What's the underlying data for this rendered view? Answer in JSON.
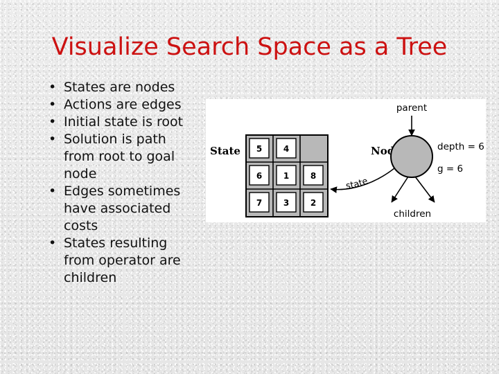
{
  "slide": {
    "title": "Visualize Search Space as a Tree",
    "title_color": "#cc1111",
    "background_color": "#e9e9e9",
    "bullet_marker": "•",
    "bullets": [
      "States are nodes",
      "Actions are edges",
      "Initial state is root",
      "Solution is path from root to goal node",
      "Edges sometimes have associated costs",
      "States resulting from operator are children"
    ]
  },
  "diagram": {
    "panel_background": "#ffffff",
    "state_label": "State",
    "node_label": "Node",
    "parent_label": "parent",
    "children_label": "children",
    "state_arc_label": "state",
    "depth_label": "depth = 6",
    "g_label": "g = 6",
    "node_fill": "#b8b8b8",
    "grid_fill": "#b8b8b8",
    "tile_fill": "#ffffff",
    "puzzle": {
      "rows": [
        [
          "5",
          "4",
          ""
        ],
        [
          "6",
          "1",
          "8"
        ],
        [
          "7",
          "3",
          "2"
        ]
      ],
      "blank_cell": {
        "row": 0,
        "col": 2
      }
    }
  }
}
